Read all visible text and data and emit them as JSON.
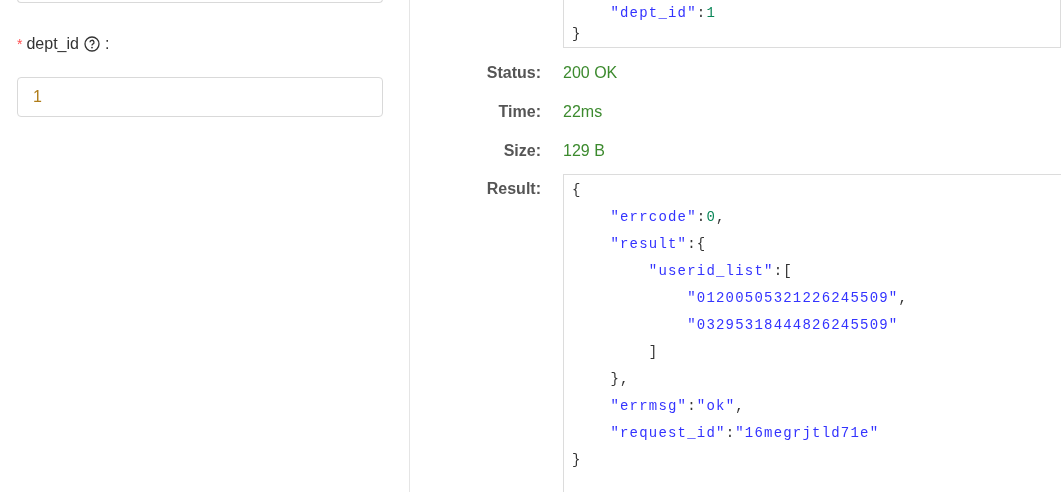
{
  "form": {
    "fields": [
      {
        "required_mark": "*",
        "label": "dept_id",
        "suffix": ":",
        "value": "1"
      }
    ]
  },
  "request_body": {
    "lines": [
      [
        {
          "kind": "key",
          "text": "    \"dept_id\""
        },
        {
          "kind": "punct",
          "text": ":"
        },
        {
          "kind": "number",
          "text": "1"
        }
      ],
      [
        {
          "kind": "punct",
          "text": "}"
        }
      ]
    ]
  },
  "response": {
    "meta": [
      {
        "label": "Status:",
        "value": "200 OK"
      },
      {
        "label": "Time:",
        "value": "22ms"
      },
      {
        "label": "Size:",
        "value": "129 B"
      }
    ],
    "result_label": "Result:",
    "lines": [
      [
        {
          "kind": "punct",
          "text": "{"
        }
      ],
      [
        {
          "kind": "key",
          "text": "    \"errcode\""
        },
        {
          "kind": "punct",
          "text": ":"
        },
        {
          "kind": "number",
          "text": "0"
        },
        {
          "kind": "punct",
          "text": ","
        }
      ],
      [
        {
          "kind": "key",
          "text": "    \"result\""
        },
        {
          "kind": "punct",
          "text": ":{"
        }
      ],
      [
        {
          "kind": "key",
          "text": "        \"userid_list\""
        },
        {
          "kind": "punct",
          "text": ":["
        }
      ],
      [
        {
          "kind": "string",
          "text": "            \"01200505321226245509\""
        },
        {
          "kind": "punct",
          "text": ","
        }
      ],
      [
        {
          "kind": "string",
          "text": "            \"03295318444826245509\""
        }
      ],
      [
        {
          "kind": "punct",
          "text": "        ]"
        }
      ],
      [
        {
          "kind": "punct",
          "text": "    },"
        }
      ],
      [
        {
          "kind": "key",
          "text": "    \"errmsg\""
        },
        {
          "kind": "punct",
          "text": ":"
        },
        {
          "kind": "string",
          "text": "\"ok\""
        },
        {
          "kind": "punct",
          "text": ","
        }
      ],
      [
        {
          "kind": "key",
          "text": "    \"request_id\""
        },
        {
          "kind": "punct",
          "text": ":"
        },
        {
          "kind": "string",
          "text": "\"16megrjtld71e\""
        }
      ],
      [
        {
          "kind": "punct",
          "text": "}"
        }
      ]
    ]
  }
}
